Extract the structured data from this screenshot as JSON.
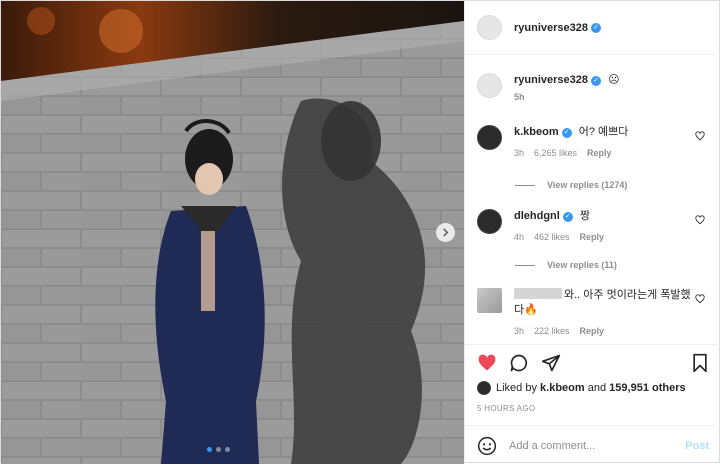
{
  "post": {
    "username": "ryuniverse328",
    "caption_time": "5h",
    "caption_emoji": "☹"
  },
  "comments": [
    {
      "user": "k.kbeom",
      "text": "어? 예쁘다",
      "time": "3h",
      "likes": "6,265 likes",
      "reply": "Reply",
      "view_replies": "View replies (1274)"
    },
    {
      "user": "dlehdgnl",
      "text": "짱",
      "time": "4h",
      "likes": "462 likes",
      "reply": "Reply",
      "view_replies": "View replies (11)"
    },
    {
      "user": "",
      "text": "와.. 아주 멋이라는게 폭발했다🔥",
      "time": "3h",
      "likes": "222 likes",
      "reply": "Reply"
    }
  ],
  "actions": {
    "liked_by_prefix": "Liked by",
    "liked_by_user": "k.kbeom",
    "liked_by_and": "and",
    "others_count": "159,951 others",
    "timestamp": "5 HOURS AGO"
  },
  "add_comment": {
    "placeholder": "Add a comment...",
    "post_label": "Post"
  },
  "icons": {
    "like": "heart-filled-icon",
    "comment": "comment-icon",
    "share": "share-icon",
    "save": "bookmark-icon",
    "emoji": "emoji-icon"
  },
  "colors": {
    "like_red": "#ed4956",
    "verified_blue": "#3897f0",
    "post_disabled": "#b2dffc"
  }
}
